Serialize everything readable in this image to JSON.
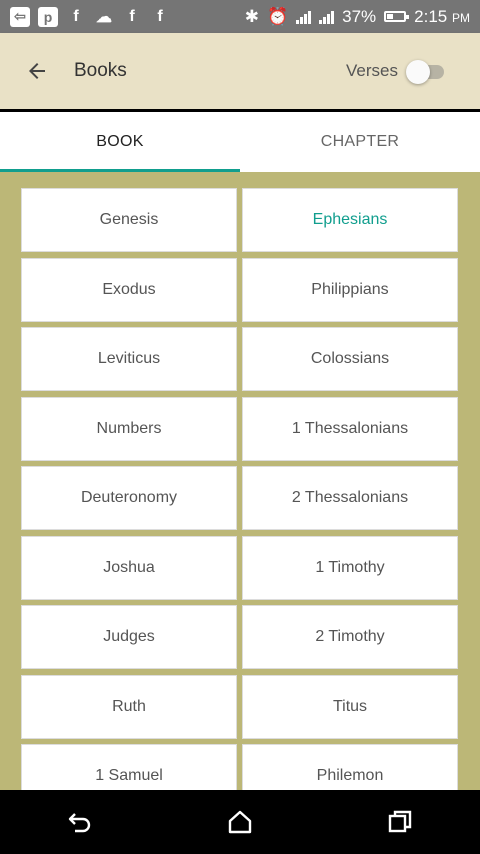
{
  "status_bar": {
    "battery": "37%",
    "time": "2:15",
    "ampm": "PM",
    "notification_icons": [
      "back-arrow-box-icon",
      "p-box-icon",
      "f-box-icon",
      "weather-icon",
      "f-box-icon",
      "f-box-icon"
    ]
  },
  "app_bar": {
    "title": "Books",
    "verses_label": "Verses",
    "verses_on": false,
    "background_color": "#e9e1c6"
  },
  "tabs": [
    {
      "label": "BOOK",
      "active": true
    },
    {
      "label": "CHAPTER",
      "active": false
    }
  ],
  "accent_color": "#119e8e",
  "grid_background_color": "#bcb777",
  "books_left": [
    "Genesis",
    "Exodus",
    "Leviticus",
    "Numbers",
    "Deuteronomy",
    "Joshua",
    "Judges",
    "Ruth",
    "1 Samuel"
  ],
  "books_right": [
    "Ephesians",
    "Philippians",
    "Colossians",
    "1 Thessalonians",
    "2 Thessalonians",
    "1 Timothy",
    "2 Timothy",
    "Titus",
    "Philemon"
  ],
  "selected_book": "Ephesians",
  "nav_bar": {
    "buttons": [
      "back-icon",
      "home-icon",
      "recents-icon"
    ]
  }
}
